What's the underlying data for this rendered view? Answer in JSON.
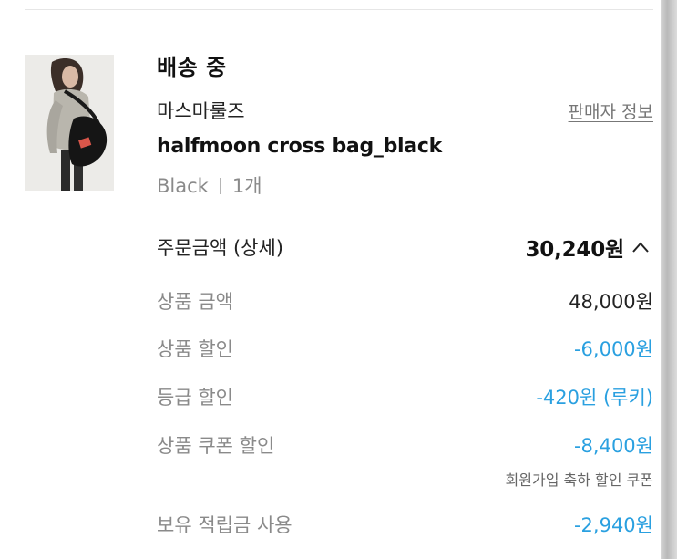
{
  "order": {
    "status": "배송 중",
    "brand": "마스마룰즈",
    "seller_link": "판매자 정보",
    "product_name": "halfmoon cross bag_black",
    "option_color": "Black",
    "option_qty": "1개"
  },
  "summary": {
    "total_label": "주문금액 (상세)",
    "total_value": "30,240원",
    "rows": [
      {
        "label": "상품 금액",
        "value": "48,000원",
        "color": "#222222"
      },
      {
        "label": "상품 할인",
        "value": "-6,000원",
        "color": "#2aa0e0"
      },
      {
        "label": "등급 할인",
        "value": "-420원 (루키)",
        "color": "#2aa0e0"
      },
      {
        "label": "상품 쿠폰 할인",
        "value": "-8,400원",
        "color": "#2aa0e0",
        "note": "회원가입 축하 할인 쿠폰"
      },
      {
        "label": "보유 적립금 사용",
        "value": "-2,940원",
        "color": "#2aa0e0"
      }
    ]
  },
  "icons": {
    "expand": "chevron-up-icon",
    "thumbnail": "product-photo"
  },
  "colors": {
    "discount": "#2aa0e0",
    "muted": "#8a8a8a",
    "text": "#222222"
  }
}
